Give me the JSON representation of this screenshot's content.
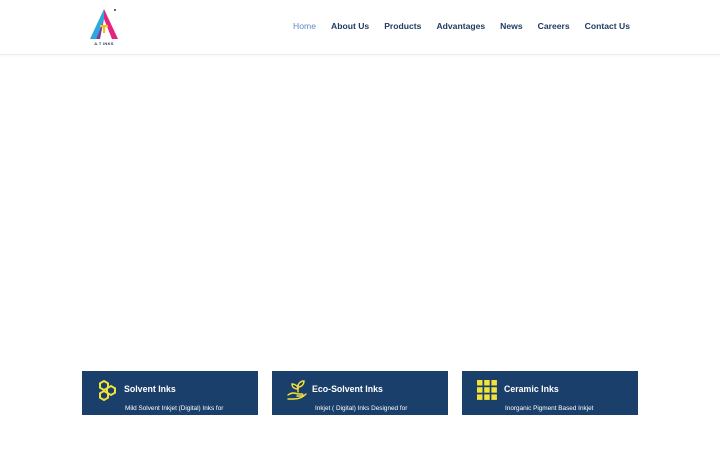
{
  "brand": {
    "logo_text": "A.T INKS"
  },
  "nav": {
    "items": [
      {
        "label": "Home",
        "active": true
      },
      {
        "label": "About Us",
        "active": false
      },
      {
        "label": "Products",
        "active": false
      },
      {
        "label": "Advantages",
        "active": false
      },
      {
        "label": "News",
        "active": false
      },
      {
        "label": "Careers",
        "active": false
      },
      {
        "label": "Contact Us",
        "active": false
      }
    ]
  },
  "cards": [
    {
      "title": "Solvent Inks",
      "description": "Mild Solvent Inkjet (Digital) Inks for",
      "icon": "hexagons-icon"
    },
    {
      "title": "Eco-Solvent Inks",
      "description": "Inkjet ( Digital) Inks Designed for",
      "icon": "plant-hand-icon"
    },
    {
      "title": "Ceramic Inks",
      "description": "Inorganic Pigment Based Inkjet",
      "icon": "grid-icon"
    }
  ],
  "colors": {
    "nav_text": "#1f3b63",
    "nav_active": "#5a8bc4",
    "card_bg": "#1b3f6b",
    "icon_yellow": "#f2e23a"
  }
}
